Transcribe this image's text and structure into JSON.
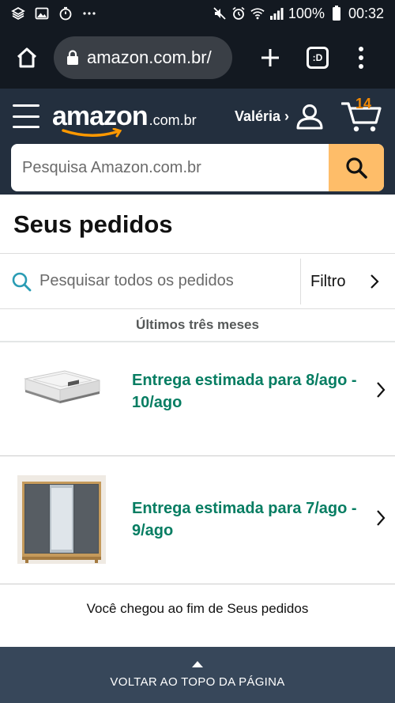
{
  "status_bar": {
    "battery": "100%",
    "time": "00:32"
  },
  "browser": {
    "url": "amazon.com.br/",
    "tabs_label": ":D"
  },
  "header": {
    "logo_text": "amazon",
    "logo_domain": ".com.br",
    "user_label": "Valéria ›",
    "cart_count": "14"
  },
  "search": {
    "placeholder": "Pesquisa Amazon.com.br"
  },
  "page": {
    "title": "Seus pedidos",
    "order_search_placeholder": "Pesquisar todos os pedidos",
    "filter_label": "Filtro",
    "period_label": "Últimos três meses",
    "end_note": "Você chegou ao fim de Seus pedidos",
    "back_to_top": "VOLTAR AO TOPO DA PÁGINA"
  },
  "orders": [
    {
      "status": "Entrega estimada para 8/ago - 10/ago",
      "image": "mattress"
    },
    {
      "status": "Entrega estimada para 7/ago - 9/ago",
      "image": "wardrobe"
    }
  ],
  "colors": {
    "status_green": "#067d62",
    "header_bg": "#232f3e",
    "search_button": "#febd69",
    "cart_count": "#f08804",
    "footer_bg": "#37475a"
  }
}
